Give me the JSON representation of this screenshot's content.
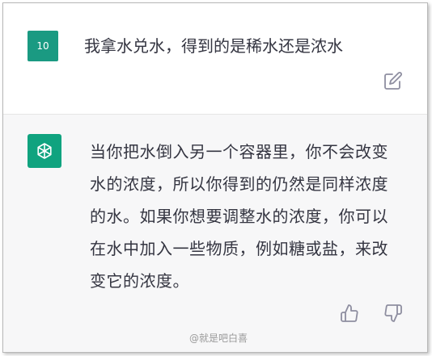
{
  "user_message": {
    "avatar_text": "10",
    "text": "我拿水兑水，得到的是稀水还是浓水"
  },
  "assistant_message": {
    "text": "当你把水倒入另一个容器里，你不会改变水的浓度，所以你得到的仍然是同样浓度的水。如果你想要调整水的浓度，你可以在水中加入一些物质，例如糖或盐，来改变它的浓度。"
  },
  "watermark": {
    "text": "@就是吧白喜"
  },
  "icons": {
    "edit": "edit-icon",
    "thumb_up": "thumbs-up-icon",
    "thumb_down": "thumbs-down-icon",
    "bot_logo": "openai-logo-icon"
  },
  "colors": {
    "avatar_green": "#1a9a82",
    "bot_green": "#10a37f",
    "assistant_bg": "#f7f7f8",
    "text": "#343541",
    "icon_gray": "#8e8ea0"
  }
}
